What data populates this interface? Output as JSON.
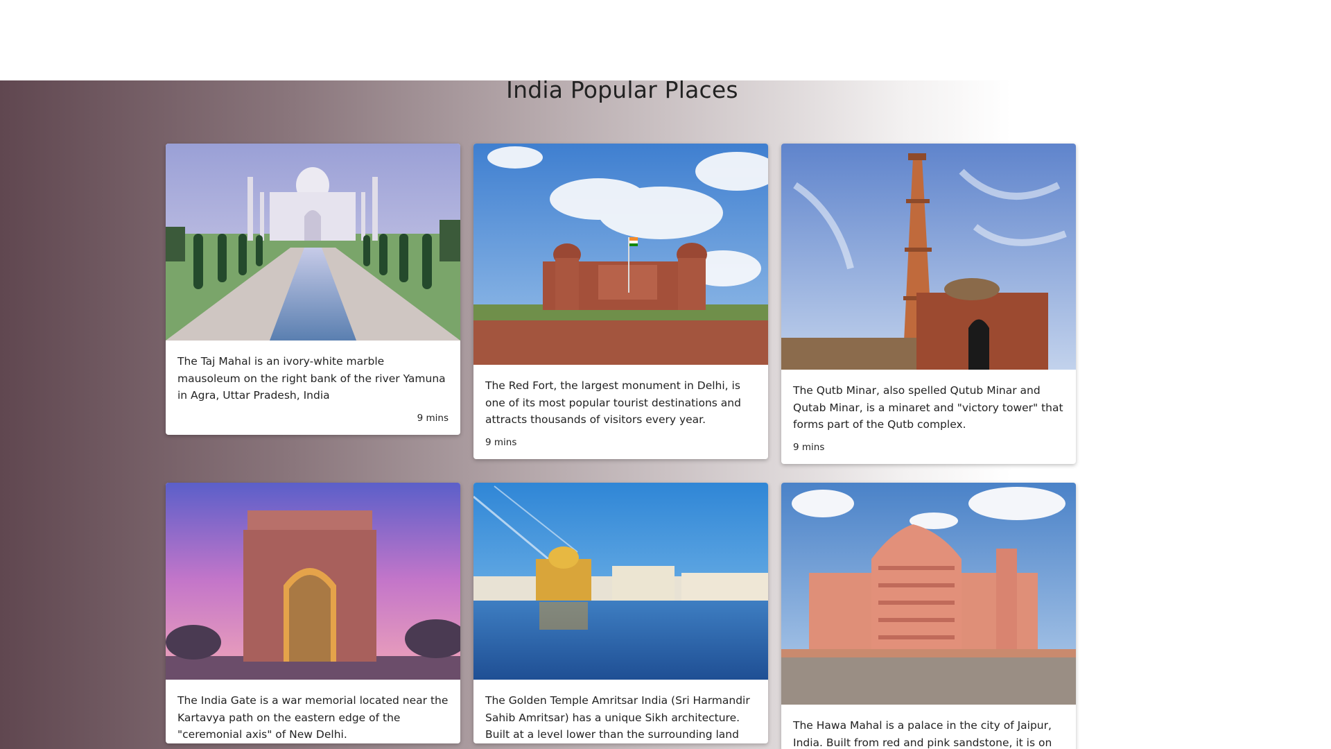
{
  "header": {
    "title": "India Popular Places"
  },
  "cards": [
    {
      "image_name": "taj-mahal-image",
      "description": "The Taj Mahal is an ivory-white marble mausoleum on the right bank of the river Yamuna in Agra, Uttar Pradesh, India",
      "time": "9 mins"
    },
    {
      "image_name": "red-fort-image",
      "description": "The Red Fort, the largest monument in Delhi, is one of its most popular tourist destinations and attracts thousands of visitors every year.",
      "time": "9 mins"
    },
    {
      "image_name": "qutb-minar-image",
      "description": "The Qutb Minar, also spelled Qutub Minar and Qutab Minar, is a minaret and \"victory tower\" that forms part of the Qutb complex.",
      "time": "9 mins"
    },
    {
      "image_name": "india-gate-image",
      "description": "The India Gate is a war memorial located near the Kartavya path on the eastern edge of the \"ceremonial axis\" of New Delhi.",
      "time": ""
    },
    {
      "image_name": "golden-temple-image",
      "description": "The Golden Temple Amritsar India (Sri Harmandir Sahib Amritsar) has a unique Sikh architecture. Built at a level lower than the surrounding land",
      "time": ""
    },
    {
      "image_name": "hawa-mahal-image",
      "description": "The Hawa Mahal is a palace in the city of Jaipur, India. Built from red and pink sandstone, it is on",
      "time": ""
    }
  ],
  "colors": {
    "gradient_start": "#604750",
    "gradient_end": "#ffffff",
    "card_bg": "#ffffff",
    "text": "#222222"
  }
}
